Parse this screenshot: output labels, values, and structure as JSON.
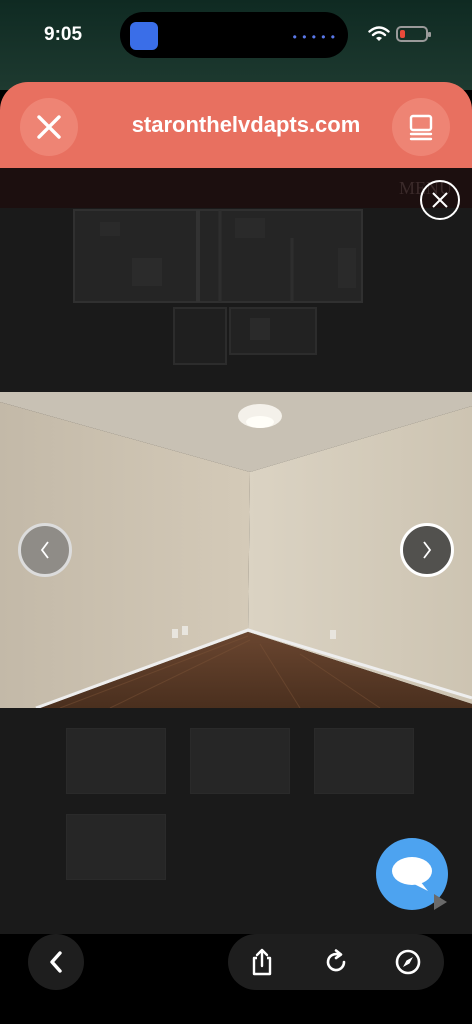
{
  "status_bar": {
    "time": "9:05",
    "icons": [
      "app-icon",
      "wifi-icon",
      "battery-low-icon"
    ],
    "battery_color": "#e74a3a"
  },
  "browser": {
    "url": "staronthelvdapts.com",
    "close_icon": "close-icon",
    "tabs_icon": "tabs-icon",
    "bar_color": "#e87060"
  },
  "page": {
    "menu_label": "MENU"
  },
  "toolbar": {
    "back_icon": "chevron-left-icon",
    "share_icon": "share-icon",
    "reload_icon": "reload-icon",
    "compass_icon": "compass-icon"
  }
}
